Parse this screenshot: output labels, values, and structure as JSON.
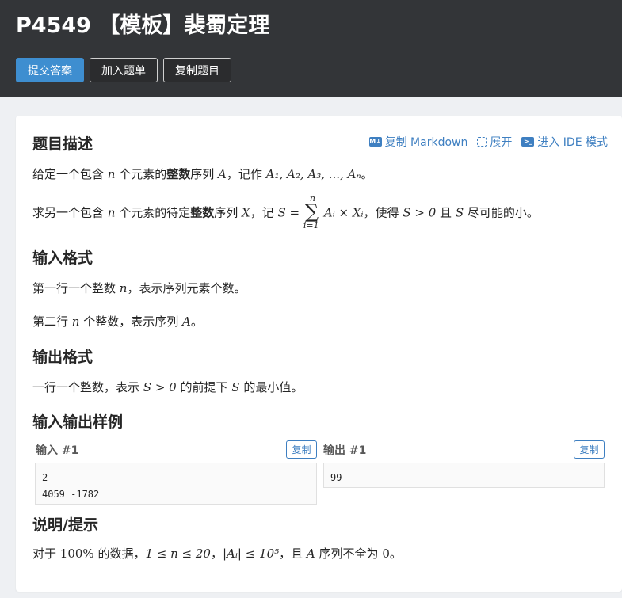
{
  "header": {
    "title": "P4549 【模板】裴蜀定理",
    "buttons": {
      "submit": "提交答案",
      "add_to_list": "加入题单",
      "copy_problem": "复制题目"
    }
  },
  "toolbar": {
    "copy_markdown": "复制 Markdown",
    "expand": "展开",
    "ide": "进入 IDE 模式"
  },
  "sections": {
    "description_title": "题目描述",
    "input_title": "输入格式",
    "output_title": "输出格式",
    "samples_title": "输入输出样例",
    "hint_title": "说明/提示"
  },
  "desc": {
    "l1_a": "给定一个包含 ",
    "l1_n": "n",
    "l1_b": " 个元素的",
    "l1_bold": "整数",
    "l1_c": "序列 ",
    "l1_A": "A",
    "l1_d": "，记作 ",
    "l1_seq": "A₁, A₂, A₃, ..., Aₙ",
    "l1_end": "。",
    "l2_a": "求另一个包含 ",
    "l2_n": "n",
    "l2_b": " 个元素的待定",
    "l2_bold": "整数",
    "l2_c": "序列 ",
    "l2_X": "X",
    "l2_d": "，记 ",
    "l2_S": "S = ",
    "l2_sum_top": "n",
    "l2_sum_bot": "i=1",
    "l2_term": "Aᵢ × Xᵢ",
    "l2_e": "，使得 ",
    "l2_cond": "S > 0",
    "l2_f": " 且 ",
    "l2_S2": "S",
    "l2_g": " 尽可能的小。"
  },
  "input": {
    "l1_a": "第一行一个整数 ",
    "l1_n": "n",
    "l1_b": "，表示序列元素个数。",
    "l2_a": "第二行 ",
    "l2_n": "n",
    "l2_b": " 个整数，表示序列 ",
    "l2_A": "A",
    "l2_end": "。"
  },
  "output": {
    "l1_a": "一行一个整数，表示 ",
    "l1_cond": "S > 0",
    "l1_b": " 的前提下 ",
    "l1_S": "S",
    "l1_c": " 的最小值。"
  },
  "samples": {
    "input_label": "输入 #1",
    "output_label": "输出 #1",
    "copy": "复制",
    "input_text": "2\n4059 -1782",
    "output_text": "99"
  },
  "hint": {
    "a": "对于 ",
    "pct": "100%",
    "b": " 的数据，",
    "range": "1 ≤ n ≤ 20",
    "c": "，",
    "abs": "|Aᵢ| ≤ 10⁵",
    "d": "，且 ",
    "A": "A",
    "e": " 序列不全为 ",
    "zero": "0",
    "f": "。"
  },
  "colors": {
    "header_bg": "#333538",
    "accent": "#3e8ed0",
    "link": "#3e7fc1"
  },
  "icons": {
    "markdown": "markdown-icon",
    "expand": "expand-icon",
    "ide": "terminal-icon"
  }
}
